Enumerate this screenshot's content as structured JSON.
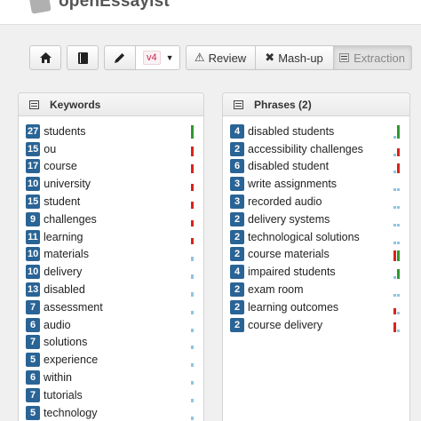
{
  "app": {
    "title": "openEssayist"
  },
  "toolbar": {
    "home_icon": "home-icon",
    "book_icon": "book-icon",
    "pencil_icon": "pencil-icon",
    "version": "v4",
    "review_label": "Review",
    "review_icon": "warning-icon",
    "mashup_label": "Mash-up",
    "mashup_icon": "shuffle-icon",
    "extraction_label": "Extraction",
    "extraction_icon": "list-icon"
  },
  "keywords": {
    "title": "Keywords",
    "items": [
      {
        "count": "27",
        "term": "students",
        "color": "#2e9a2e",
        "h": 1.0
      },
      {
        "count": "15",
        "term": "ou",
        "color": "#d9231a",
        "h": 0.75
      },
      {
        "count": "17",
        "term": "course",
        "color": "#d9231a",
        "h": 0.65
      },
      {
        "count": "10",
        "term": "university",
        "color": "#d9231a",
        "h": 0.55
      },
      {
        "count": "15",
        "term": "student",
        "color": "#d9231a",
        "h": 0.55
      },
      {
        "count": "9",
        "term": "challenges",
        "color": "#d9231a",
        "h": 0.45
      },
      {
        "count": "11",
        "term": "learning",
        "color": "#d9231a",
        "h": 0.45
      },
      {
        "count": "10",
        "term": "materials",
        "color": "#8fc5e0",
        "h": 0.3
      },
      {
        "count": "10",
        "term": "delivery",
        "color": "#8fc5e0",
        "h": 0.3
      },
      {
        "count": "13",
        "term": "disabled",
        "color": "#8fc5e0",
        "h": 0.3
      },
      {
        "count": "7",
        "term": "assessment",
        "color": "#8fc5e0",
        "h": 0.25
      },
      {
        "count": "6",
        "term": "audio",
        "color": "#8fc5e0",
        "h": 0.25
      },
      {
        "count": "7",
        "term": "solutions",
        "color": "#8fc5e0",
        "h": 0.25
      },
      {
        "count": "5",
        "term": "experience",
        "color": "#8fc5e0",
        "h": 0.25
      },
      {
        "count": "6",
        "term": "within",
        "color": "#8fc5e0",
        "h": 0.25
      },
      {
        "count": "7",
        "term": "tutorials",
        "color": "#8fc5e0",
        "h": 0.25
      },
      {
        "count": "5",
        "term": "technology",
        "color": "#8fc5e0",
        "h": 0.25
      }
    ]
  },
  "phrases": {
    "title": "Phrases (2)",
    "items": [
      {
        "count": "4",
        "term": "disabled students",
        "c1": "#8fc5e0",
        "h1": 0.2,
        "c2": "#2e9a2e",
        "h2": 1.0
      },
      {
        "count": "2",
        "term": "accessibility challenges",
        "c1": "#8fc5e0",
        "h1": 0.2,
        "c2": "#d9231a",
        "h2": 0.6
      },
      {
        "count": "6",
        "term": "disabled student",
        "c1": "#8fc5e0",
        "h1": 0.2,
        "c2": "#d9231a",
        "h2": 0.7
      },
      {
        "count": "3",
        "term": "write assignments",
        "c1": "#8fc5e0",
        "h1": 0.2,
        "c2": "#8fc5e0",
        "h2": 0.2
      },
      {
        "count": "3",
        "term": "recorded audio",
        "c1": "#8fc5e0",
        "h1": 0.2,
        "c2": "#8fc5e0",
        "h2": 0.2
      },
      {
        "count": "2",
        "term": "delivery systems",
        "c1": "#8fc5e0",
        "h1": 0.2,
        "c2": "#8fc5e0",
        "h2": 0.2
      },
      {
        "count": "2",
        "term": "technological solutions",
        "c1": "#8fc5e0",
        "h1": 0.2,
        "c2": "#8fc5e0",
        "h2": 0.2
      },
      {
        "count": "2",
        "term": "course materials",
        "c1": "#d9231a",
        "h1": 0.8,
        "c2": "#2e9a2e",
        "h2": 0.8
      },
      {
        "count": "4",
        "term": "impaired students",
        "c1": "#8fc5e0",
        "h1": 0.2,
        "c2": "#2e9a2e",
        "h2": 0.75
      },
      {
        "count": "2",
        "term": "exam room",
        "c1": "#8fc5e0",
        "h1": 0.2,
        "c2": "#8fc5e0",
        "h2": 0.2
      },
      {
        "count": "2",
        "term": "learning outcomes",
        "c1": "#d9231a",
        "h1": 0.45,
        "c2": "#8fc5e0",
        "h2": 0.2
      },
      {
        "count": "2",
        "term": "course delivery",
        "c1": "#d9231a",
        "h1": 0.75,
        "c2": "#8fc5e0",
        "h2": 0.2
      }
    ]
  }
}
